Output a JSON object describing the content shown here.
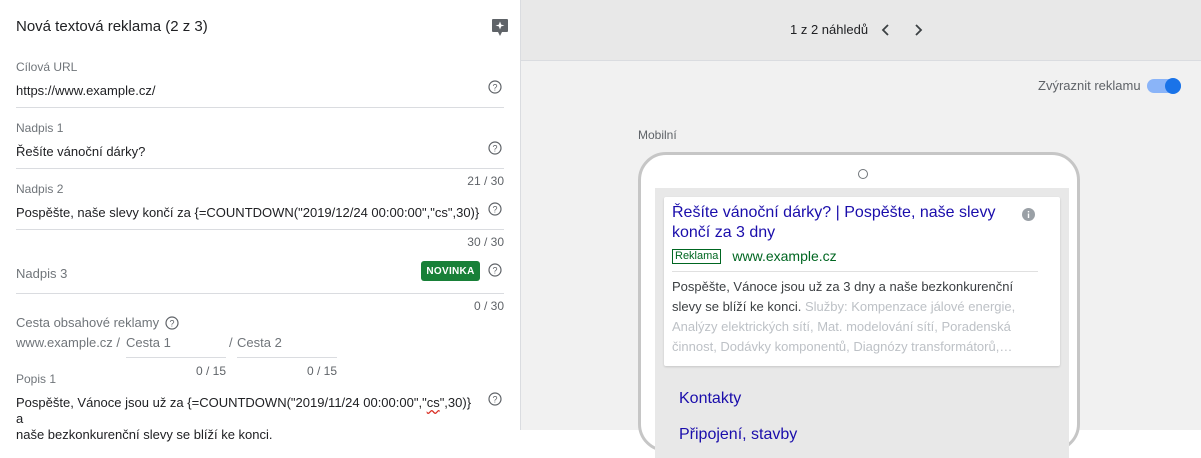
{
  "form": {
    "title": "Nová textová reklama (2 z 3)",
    "fields": {
      "url": {
        "label": "Cílová URL",
        "value": "https://www.example.cz/"
      },
      "headline1": {
        "label": "Nadpis 1",
        "value": "Řešíte vánoční dárky?",
        "counter": "21 / 30"
      },
      "headline2": {
        "label": "Nadpis 2",
        "value": "Pospěšte, naše slevy končí za {=COUNTDOWN(\"2019/12/24 00:00:00\",\"cs\",30)}",
        "counter": "30 / 30"
      },
      "headline3": {
        "label": "Nadpis 3",
        "value": "",
        "badge": "NOVINKA",
        "counter": "0 / 30"
      },
      "path": {
        "label": "Cesta obsahové reklamy",
        "domain": "www.example.cz /",
        "path1_placeholder": "Cesta 1",
        "path2_separator": "/",
        "path2_placeholder": "Cesta 2",
        "counter1": "0 / 15",
        "counter2": "0 / 15"
      },
      "description1": {
        "label": "Popis 1",
        "value_part1": "Pospěšte, Vánoce jsou už za {=COUNTDOWN(\"2019/11/24 00:00:00\",\"",
        "value_spell": "cs",
        "value_part2": "\",30)} a",
        "value_line2": "naše bezkonkurenční slevy se blíží ke konci."
      }
    }
  },
  "preview": {
    "pager": "1 z 2 náhledů",
    "toggle_label": "Zvýraznit reklamu",
    "toggle_on": true,
    "device_label": "Mobilní",
    "ad": {
      "headline": "Řešíte vánoční dárky? | Pospěšte, naše slevy končí za 3 dny",
      "badge": "Reklama",
      "display_url": "www.example.cz",
      "description": "Pospěšte, Vánoce jsou už za 3 dny a naše bezkonkurenční slevy se blíží ke konci.",
      "snippet": "Služby: Kompenzace jálové energie, Analýzy elektrických sítí, Mat. modelování sítí, Poradenská činnost, Dodávky komponentů, Diagnózy transformátorů,…"
    },
    "sitelinks": [
      "Kontakty",
      "Připojení, stavby"
    ]
  },
  "colors": {
    "accent_blue": "#1a73e8",
    "badge_green": "#188038",
    "link": "#1a0dab",
    "url_green": "#006621"
  },
  "icons": [
    "tip-icon",
    "help-icon",
    "chevron-left-icon",
    "chevron-right-icon",
    "info-icon"
  ]
}
